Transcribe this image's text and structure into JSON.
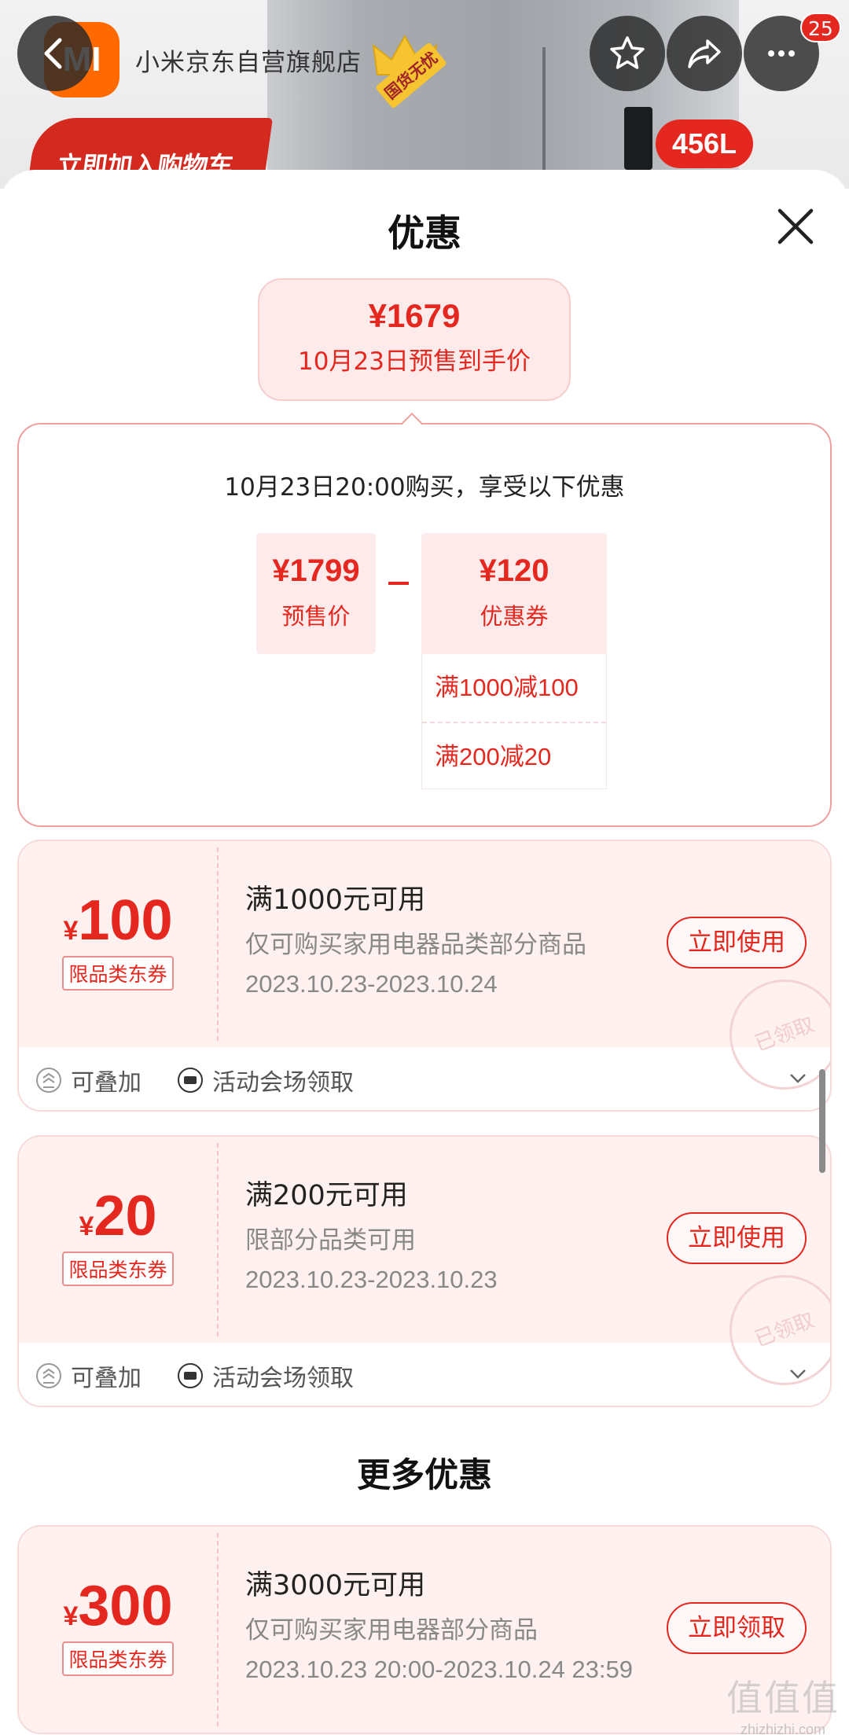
{
  "header": {
    "store_logo_text": "MI",
    "store_name": "小米京东自营旗舰店",
    "gov_badge": "国货无忧",
    "cart_banner": "立即加入购物车",
    "capacity_badge": "456L",
    "message_count": "25",
    "icons": [
      "back-arrow-icon",
      "star-icon",
      "share-icon",
      "more-icon"
    ]
  },
  "sheet": {
    "title": "优惠",
    "final_price": {
      "amount": "¥1679",
      "label": "10月23日预售到手价"
    },
    "calc": {
      "heading": "10月23日20:00购买，享受以下优惠",
      "presale": {
        "amount": "¥1799",
        "label": "预售价"
      },
      "operator": "–",
      "coupon": {
        "amount": "¥120",
        "label": "优惠券"
      },
      "rules": [
        "满1000减100",
        "满200减20"
      ]
    }
  },
  "coupons": [
    {
      "yen": "¥",
      "amount": "100",
      "tag": "限品类东券",
      "condition": "满1000元可用",
      "desc": "仅可购买家用电器品类部分商品",
      "date": "2023.10.23-2023.10.24",
      "button": "立即使用",
      "stamp": "已领取",
      "stackable": "可叠加",
      "source": "活动会场领取"
    },
    {
      "yen": "¥",
      "amount": "20",
      "tag": "限品类东券",
      "condition": "满200元可用",
      "desc": "限部分品类可用",
      "date": "2023.10.23-2023.10.23",
      "button": "立即使用",
      "stamp": "已领取",
      "stackable": "可叠加",
      "source": "活动会场领取"
    }
  ],
  "more": {
    "title": "更多优惠",
    "coupon": {
      "yen": "¥",
      "amount": "300",
      "tag": "限品类东券",
      "condition": "满3000元可用",
      "desc": "仅可购买家用电器部分商品",
      "date": "2023.10.23 20:00-2023.10.24 23:59",
      "button": "立即领取"
    }
  },
  "watermark": {
    "logo": "值值值",
    "url": "zhizhizhi.com"
  },
  "colors": {
    "accent": "#e4281f",
    "coupon_bg": "#fff1f0",
    "brand_orange": "#ff6a00"
  }
}
